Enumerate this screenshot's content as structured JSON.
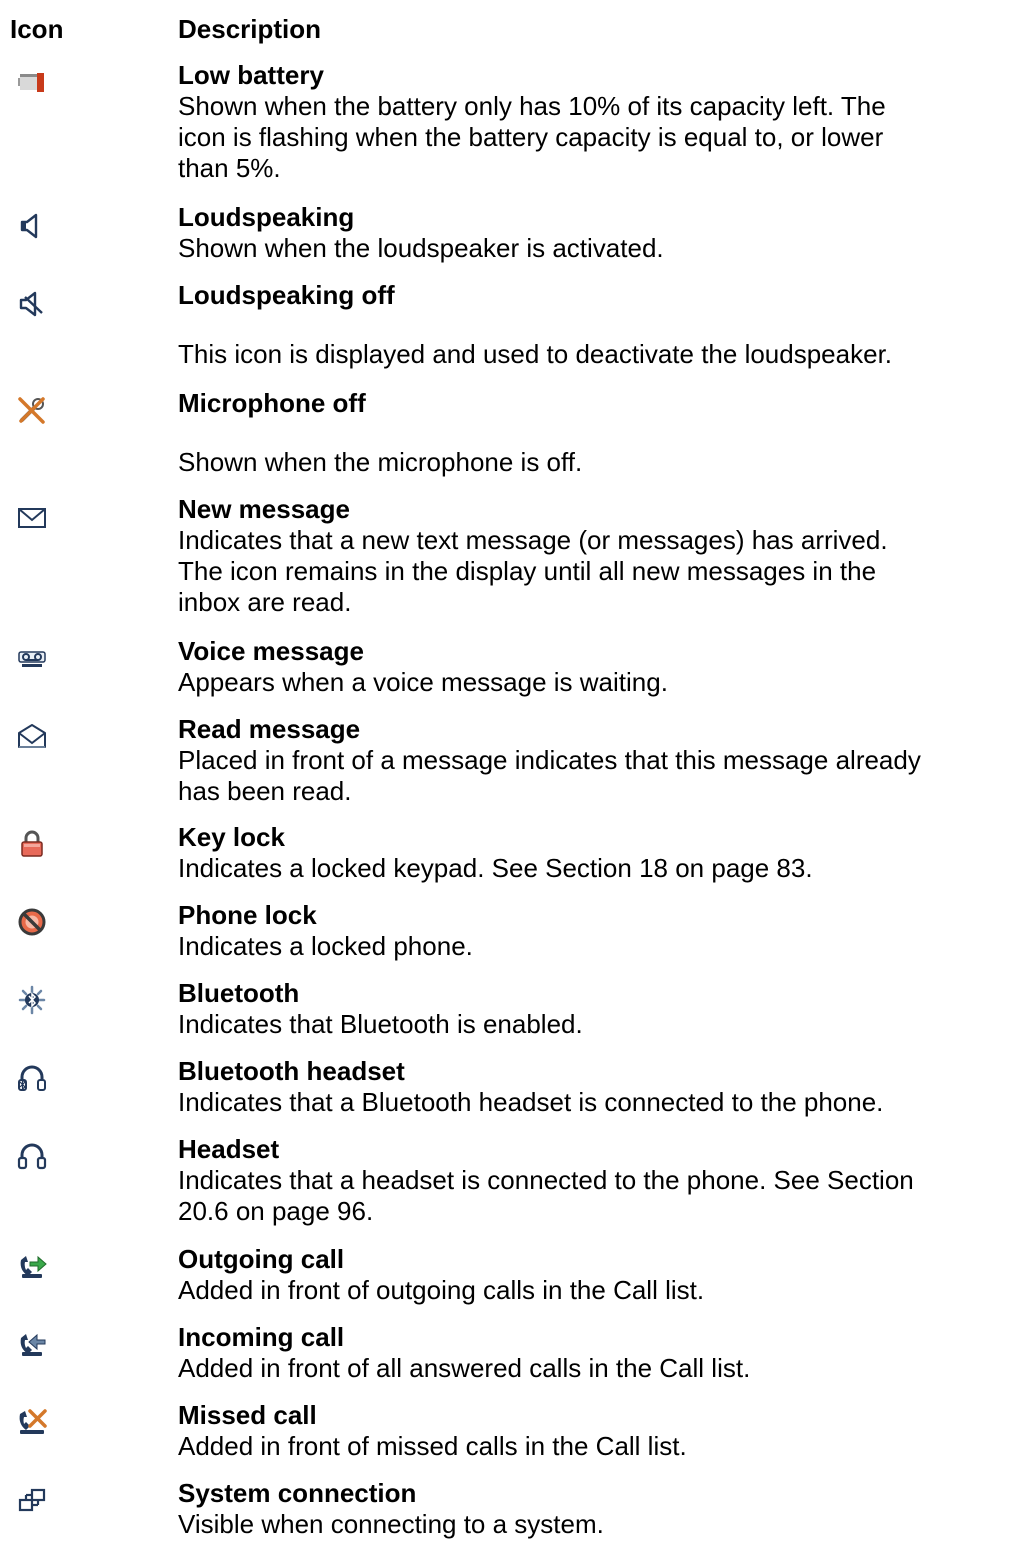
{
  "header": {
    "icon_col": "Icon",
    "desc_col": "Description"
  },
  "rows": [
    {
      "icon": "low-battery-icon",
      "title": "Low battery",
      "desc": "Shown when the battery only has 10% of its capacity left. The\nicon is flashing when the battery capacity is equal to, or lower\nthan 5%."
    },
    {
      "icon": "loudspeaker-icon",
      "title": "Loudspeaking",
      "desc": "Shown when the loudspeaker is activated."
    },
    {
      "icon": "loudspeaker-off-icon",
      "title": "Loudspeaking off",
      "desc": "This icon is displayed and used to deactivate the loudspeaker."
    },
    {
      "icon": "microphone-off-icon",
      "title": "Microphone off",
      "desc": "Shown when the microphone is off."
    },
    {
      "icon": "new-message-icon",
      "title": "New message",
      "desc": "Indicates that a new text message (or messages) has arrived.\nThe icon remains in the display until all new messages in the\ninbox are read."
    },
    {
      "icon": "voice-message-icon",
      "title": "Voice message",
      "desc": "Appears when a voice message is waiting."
    },
    {
      "icon": "read-message-icon",
      "title": "Read message",
      "desc": "Placed in front of a message indicates that this message already\nhas been read."
    },
    {
      "icon": "key-lock-icon",
      "title": "Key lock",
      "desc": "Indicates a locked keypad. See Section 18 on page 83."
    },
    {
      "icon": "phone-lock-icon",
      "title": "Phone lock",
      "desc": "Indicates a locked phone."
    },
    {
      "icon": "bluetooth-icon",
      "title": "Bluetooth",
      "desc": "Indicates that Bluetooth is enabled."
    },
    {
      "icon": "bluetooth-headset-icon",
      "title": "Bluetooth headset",
      "desc": "Indicates that a Bluetooth headset is connected to the phone."
    },
    {
      "icon": "headset-icon",
      "title": "Headset",
      "desc": "Indicates that a headset is connected to the phone. See Section\n20.6 on page 96."
    },
    {
      "icon": "outgoing-call-icon",
      "title": "Outgoing call",
      "desc": "Added in front of outgoing calls in the Call list."
    },
    {
      "icon": "incoming-call-icon",
      "title": "Incoming call",
      "desc": "Added in front of all answered calls in the Call list."
    },
    {
      "icon": "missed-call-icon",
      "title": "Missed call",
      "desc": "Added in front of missed calls in the Call list."
    },
    {
      "icon": "system-connection-icon",
      "title": "System connection",
      "desc": "Visible when connecting to a system."
    }
  ]
}
